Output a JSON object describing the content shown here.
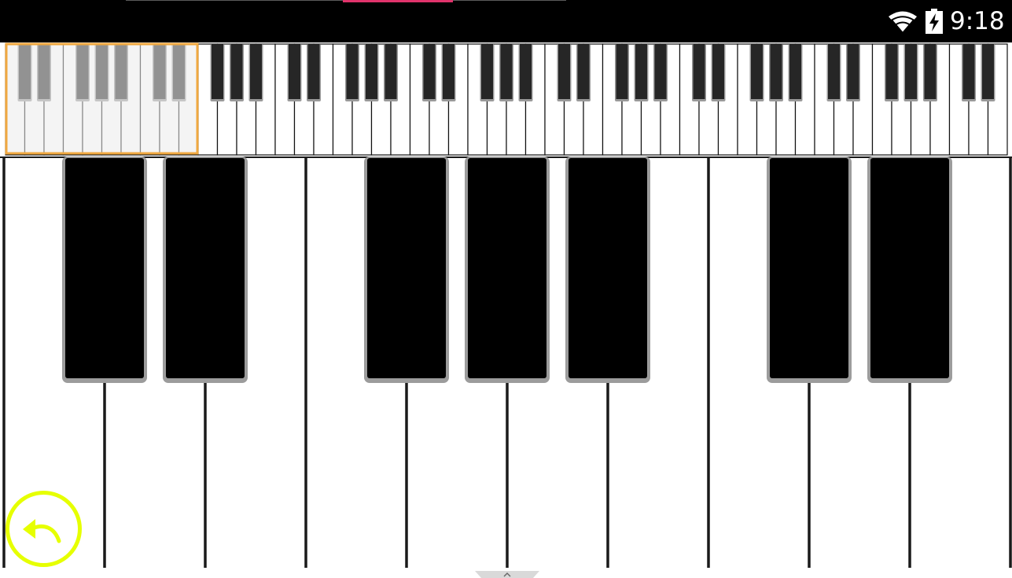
{
  "status_bar": {
    "time": "9:18",
    "wifi_icon": "wifi-icon",
    "battery_icon": "battery-charging-icon",
    "accent_color": "#e0336b"
  },
  "overview_keyboard": {
    "visible_white_keys": 52,
    "selection_start_white_key": 0,
    "selection_white_key_count": 10,
    "selection_color": "#f0a840"
  },
  "main_keyboard": {
    "visible_white_keys": 10,
    "black_key_pattern": [
      1,
      1,
      0,
      1,
      1,
      1,
      0
    ],
    "first_white_key_partial": true
  },
  "controls": {
    "back_icon": "reply-arrow-icon",
    "back_color": "#e6ff00"
  },
  "nav": {
    "handle_icon": "chevron-up-icon"
  }
}
